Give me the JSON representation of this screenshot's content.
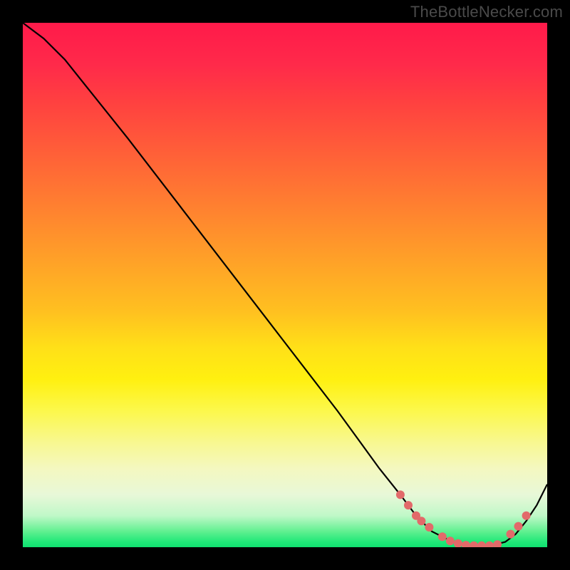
{
  "watermark": "TheBottleNecker.com",
  "chart_data": {
    "type": "line",
    "title": "",
    "xlabel": "",
    "ylabel": "",
    "xlim": [
      0,
      100
    ],
    "ylim": [
      0,
      100
    ],
    "series": [
      {
        "name": "curve",
        "x": [
          0,
          4,
          8,
          12,
          20,
          30,
          40,
          50,
          60,
          68,
          72,
          75,
          78,
          80,
          82,
          84,
          86,
          88,
          90,
          92,
          94,
          96,
          98,
          100
        ],
        "y": [
          100,
          97,
          93,
          88,
          78,
          65,
          52,
          39,
          26,
          15,
          10,
          6,
          3,
          2,
          1,
          0.5,
          0.3,
          0.3,
          0.5,
          1,
          2.5,
          5,
          8,
          12
        ]
      }
    ],
    "markers": {
      "name": "highlight-points",
      "color": "#e26a6a",
      "x": [
        72,
        73.5,
        75,
        76,
        77.5,
        80,
        81.5,
        83,
        84.5,
        86,
        87.5,
        89,
        90.5,
        93,
        94.5,
        96
      ],
      "y": [
        10,
        8,
        6,
        5,
        3.8,
        2,
        1.2,
        0.7,
        0.4,
        0.3,
        0.3,
        0.3,
        0.5,
        2.5,
        4,
        6
      ]
    },
    "gradient_stops": [
      {
        "pos": 0,
        "color": "#ff1a4a"
      },
      {
        "pos": 25,
        "color": "#ff6038"
      },
      {
        "pos": 50,
        "color": "#ffc020"
      },
      {
        "pos": 70,
        "color": "#fff010"
      },
      {
        "pos": 90,
        "color": "#e8f8d8"
      },
      {
        "pos": 100,
        "color": "#10e070"
      }
    ]
  }
}
